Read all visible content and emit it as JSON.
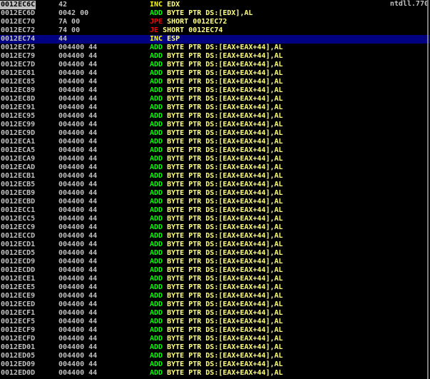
{
  "module": "ntdll.770",
  "current_address": "0012EC6C",
  "selected_address": "0012EC74",
  "colors": {
    "background": "#000000",
    "text": "#c0c0c0",
    "selection": "#000080",
    "inc": "#ffff00",
    "add": "#00ff00",
    "jump": "#ff0000",
    "operand": "#ffff80"
  },
  "rows": [
    {
      "addr": "0012EC6C",
      "hex": "42",
      "mnem": "INC",
      "ops": "EDX",
      "kind": "inc"
    },
    {
      "addr": "0012EC6D",
      "hex": "0042 00",
      "mnem": "ADD",
      "ops": "BYTE PTR DS:[EDX],AL",
      "kind": "add"
    },
    {
      "addr": "0012EC70",
      "hex": "7A 00",
      "mnem": "JPE",
      "ops": "SHORT 0012EC72",
      "kind": "jump"
    },
    {
      "addr": "0012EC72",
      "hex": "74 00",
      "mnem": "JE",
      "ops": "SHORT 0012EC74",
      "kind": "jump"
    },
    {
      "addr": "0012EC74",
      "hex": "44",
      "mnem": "INC",
      "ops": "ESP",
      "kind": "inc"
    },
    {
      "addr": "0012EC75",
      "hex": "004400 44",
      "mnem": "ADD",
      "ops": "BYTE PTR DS:[EAX+EAX+44],AL",
      "kind": "add"
    },
    {
      "addr": "0012EC79",
      "hex": "004400 44",
      "mnem": "ADD",
      "ops": "BYTE PTR DS:[EAX+EAX+44],AL",
      "kind": "add"
    },
    {
      "addr": "0012EC7D",
      "hex": "004400 44",
      "mnem": "ADD",
      "ops": "BYTE PTR DS:[EAX+EAX+44],AL",
      "kind": "add"
    },
    {
      "addr": "0012EC81",
      "hex": "004400 44",
      "mnem": "ADD",
      "ops": "BYTE PTR DS:[EAX+EAX+44],AL",
      "kind": "add"
    },
    {
      "addr": "0012EC85",
      "hex": "004400 44",
      "mnem": "ADD",
      "ops": "BYTE PTR DS:[EAX+EAX+44],AL",
      "kind": "add"
    },
    {
      "addr": "0012EC89",
      "hex": "004400 44",
      "mnem": "ADD",
      "ops": "BYTE PTR DS:[EAX+EAX+44],AL",
      "kind": "add"
    },
    {
      "addr": "0012EC8D",
      "hex": "004400 44",
      "mnem": "ADD",
      "ops": "BYTE PTR DS:[EAX+EAX+44],AL",
      "kind": "add"
    },
    {
      "addr": "0012EC91",
      "hex": "004400 44",
      "mnem": "ADD",
      "ops": "BYTE PTR DS:[EAX+EAX+44],AL",
      "kind": "add"
    },
    {
      "addr": "0012EC95",
      "hex": "004400 44",
      "mnem": "ADD",
      "ops": "BYTE PTR DS:[EAX+EAX+44],AL",
      "kind": "add"
    },
    {
      "addr": "0012EC99",
      "hex": "004400 44",
      "mnem": "ADD",
      "ops": "BYTE PTR DS:[EAX+EAX+44],AL",
      "kind": "add"
    },
    {
      "addr": "0012EC9D",
      "hex": "004400 44",
      "mnem": "ADD",
      "ops": "BYTE PTR DS:[EAX+EAX+44],AL",
      "kind": "add"
    },
    {
      "addr": "0012ECA1",
      "hex": "004400 44",
      "mnem": "ADD",
      "ops": "BYTE PTR DS:[EAX+EAX+44],AL",
      "kind": "add"
    },
    {
      "addr": "0012ECA5",
      "hex": "004400 44",
      "mnem": "ADD",
      "ops": "BYTE PTR DS:[EAX+EAX+44],AL",
      "kind": "add"
    },
    {
      "addr": "0012ECA9",
      "hex": "004400 44",
      "mnem": "ADD",
      "ops": "BYTE PTR DS:[EAX+EAX+44],AL",
      "kind": "add"
    },
    {
      "addr": "0012ECAD",
      "hex": "004400 44",
      "mnem": "ADD",
      "ops": "BYTE PTR DS:[EAX+EAX+44],AL",
      "kind": "add"
    },
    {
      "addr": "0012ECB1",
      "hex": "004400 44",
      "mnem": "ADD",
      "ops": "BYTE PTR DS:[EAX+EAX+44],AL",
      "kind": "add"
    },
    {
      "addr": "0012ECB5",
      "hex": "004400 44",
      "mnem": "ADD",
      "ops": "BYTE PTR DS:[EAX+EAX+44],AL",
      "kind": "add"
    },
    {
      "addr": "0012ECB9",
      "hex": "004400 44",
      "mnem": "ADD",
      "ops": "BYTE PTR DS:[EAX+EAX+44],AL",
      "kind": "add"
    },
    {
      "addr": "0012ECBD",
      "hex": "004400 44",
      "mnem": "ADD",
      "ops": "BYTE PTR DS:[EAX+EAX+44],AL",
      "kind": "add"
    },
    {
      "addr": "0012ECC1",
      "hex": "004400 44",
      "mnem": "ADD",
      "ops": "BYTE PTR DS:[EAX+EAX+44],AL",
      "kind": "add"
    },
    {
      "addr": "0012ECC5",
      "hex": "004400 44",
      "mnem": "ADD",
      "ops": "BYTE PTR DS:[EAX+EAX+44],AL",
      "kind": "add"
    },
    {
      "addr": "0012ECC9",
      "hex": "004400 44",
      "mnem": "ADD",
      "ops": "BYTE PTR DS:[EAX+EAX+44],AL",
      "kind": "add"
    },
    {
      "addr": "0012ECCD",
      "hex": "004400 44",
      "mnem": "ADD",
      "ops": "BYTE PTR DS:[EAX+EAX+44],AL",
      "kind": "add"
    },
    {
      "addr": "0012ECD1",
      "hex": "004400 44",
      "mnem": "ADD",
      "ops": "BYTE PTR DS:[EAX+EAX+44],AL",
      "kind": "add"
    },
    {
      "addr": "0012ECD5",
      "hex": "004400 44",
      "mnem": "ADD",
      "ops": "BYTE PTR DS:[EAX+EAX+44],AL",
      "kind": "add"
    },
    {
      "addr": "0012ECD9",
      "hex": "004400 44",
      "mnem": "ADD",
      "ops": "BYTE PTR DS:[EAX+EAX+44],AL",
      "kind": "add"
    },
    {
      "addr": "0012ECDD",
      "hex": "004400 44",
      "mnem": "ADD",
      "ops": "BYTE PTR DS:[EAX+EAX+44],AL",
      "kind": "add"
    },
    {
      "addr": "0012ECE1",
      "hex": "004400 44",
      "mnem": "ADD",
      "ops": "BYTE PTR DS:[EAX+EAX+44],AL",
      "kind": "add"
    },
    {
      "addr": "0012ECE5",
      "hex": "004400 44",
      "mnem": "ADD",
      "ops": "BYTE PTR DS:[EAX+EAX+44],AL",
      "kind": "add"
    },
    {
      "addr": "0012ECE9",
      "hex": "004400 44",
      "mnem": "ADD",
      "ops": "BYTE PTR DS:[EAX+EAX+44],AL",
      "kind": "add"
    },
    {
      "addr": "0012ECED",
      "hex": "004400 44",
      "mnem": "ADD",
      "ops": "BYTE PTR DS:[EAX+EAX+44],AL",
      "kind": "add"
    },
    {
      "addr": "0012ECF1",
      "hex": "004400 44",
      "mnem": "ADD",
      "ops": "BYTE PTR DS:[EAX+EAX+44],AL",
      "kind": "add"
    },
    {
      "addr": "0012ECF5",
      "hex": "004400 44",
      "mnem": "ADD",
      "ops": "BYTE PTR DS:[EAX+EAX+44],AL",
      "kind": "add"
    },
    {
      "addr": "0012ECF9",
      "hex": "004400 44",
      "mnem": "ADD",
      "ops": "BYTE PTR DS:[EAX+EAX+44],AL",
      "kind": "add"
    },
    {
      "addr": "0012ECFD",
      "hex": "004400 44",
      "mnem": "ADD",
      "ops": "BYTE PTR DS:[EAX+EAX+44],AL",
      "kind": "add"
    },
    {
      "addr": "0012ED01",
      "hex": "004400 44",
      "mnem": "ADD",
      "ops": "BYTE PTR DS:[EAX+EAX+44],AL",
      "kind": "add"
    },
    {
      "addr": "0012ED05",
      "hex": "004400 44",
      "mnem": "ADD",
      "ops": "BYTE PTR DS:[EAX+EAX+44],AL",
      "kind": "add"
    },
    {
      "addr": "0012ED09",
      "hex": "004400 44",
      "mnem": "ADD",
      "ops": "BYTE PTR DS:[EAX+EAX+44],AL",
      "kind": "add"
    },
    {
      "addr": "0012ED0D",
      "hex": "004400 44",
      "mnem": "ADD",
      "ops": "BYTE PTR DS:[EAX+EAX+44],AL",
      "kind": "add"
    }
  ]
}
